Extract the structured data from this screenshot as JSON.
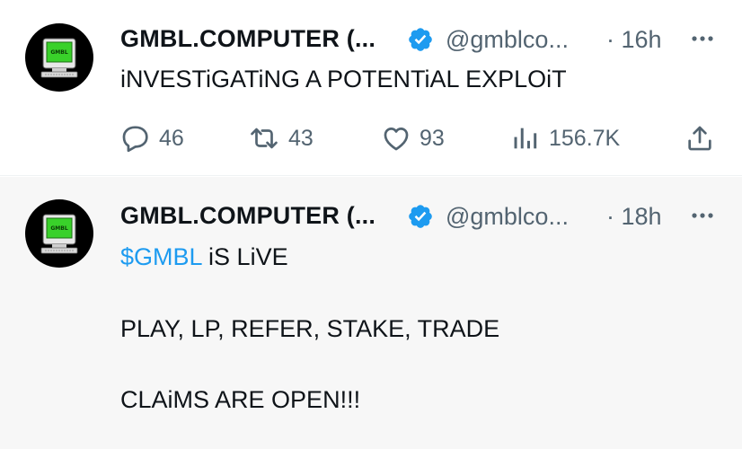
{
  "tweets": [
    {
      "author_name": "GMBL.COMPUTER (...",
      "handle": "@gmblco...",
      "time": "· 16h",
      "text": "iNVESTiGATiNG A POTENTiAL EXPLOiT",
      "avatar_label": "GMBL",
      "metrics": {
        "replies": "46",
        "reposts": "43",
        "likes": "93",
        "views": "156.7K"
      }
    },
    {
      "author_name": "GMBL.COMPUTER (...",
      "handle": "@gmblco...",
      "time": "· 18h",
      "avatar_label": "GMBL",
      "cashtag": "$GMBL",
      "line1_rest": " iS LiVE",
      "line2": "PLAY, LP, REFER, STAKE, TRADE",
      "line3": "CLAiMS ARE OPEN!!!"
    }
  ],
  "colors": {
    "verified_blue": "#1d9bf0",
    "cashtag_blue": "#1d9bf0",
    "secondary_text": "#536471",
    "avatar_screen_green": "#39d12a"
  },
  "icons": {
    "verified": "verified-badge-icon",
    "more": "more-icon",
    "reply": "reply-icon",
    "repost": "repost-icon",
    "like": "like-icon",
    "views": "views-icon",
    "share": "share-icon"
  }
}
